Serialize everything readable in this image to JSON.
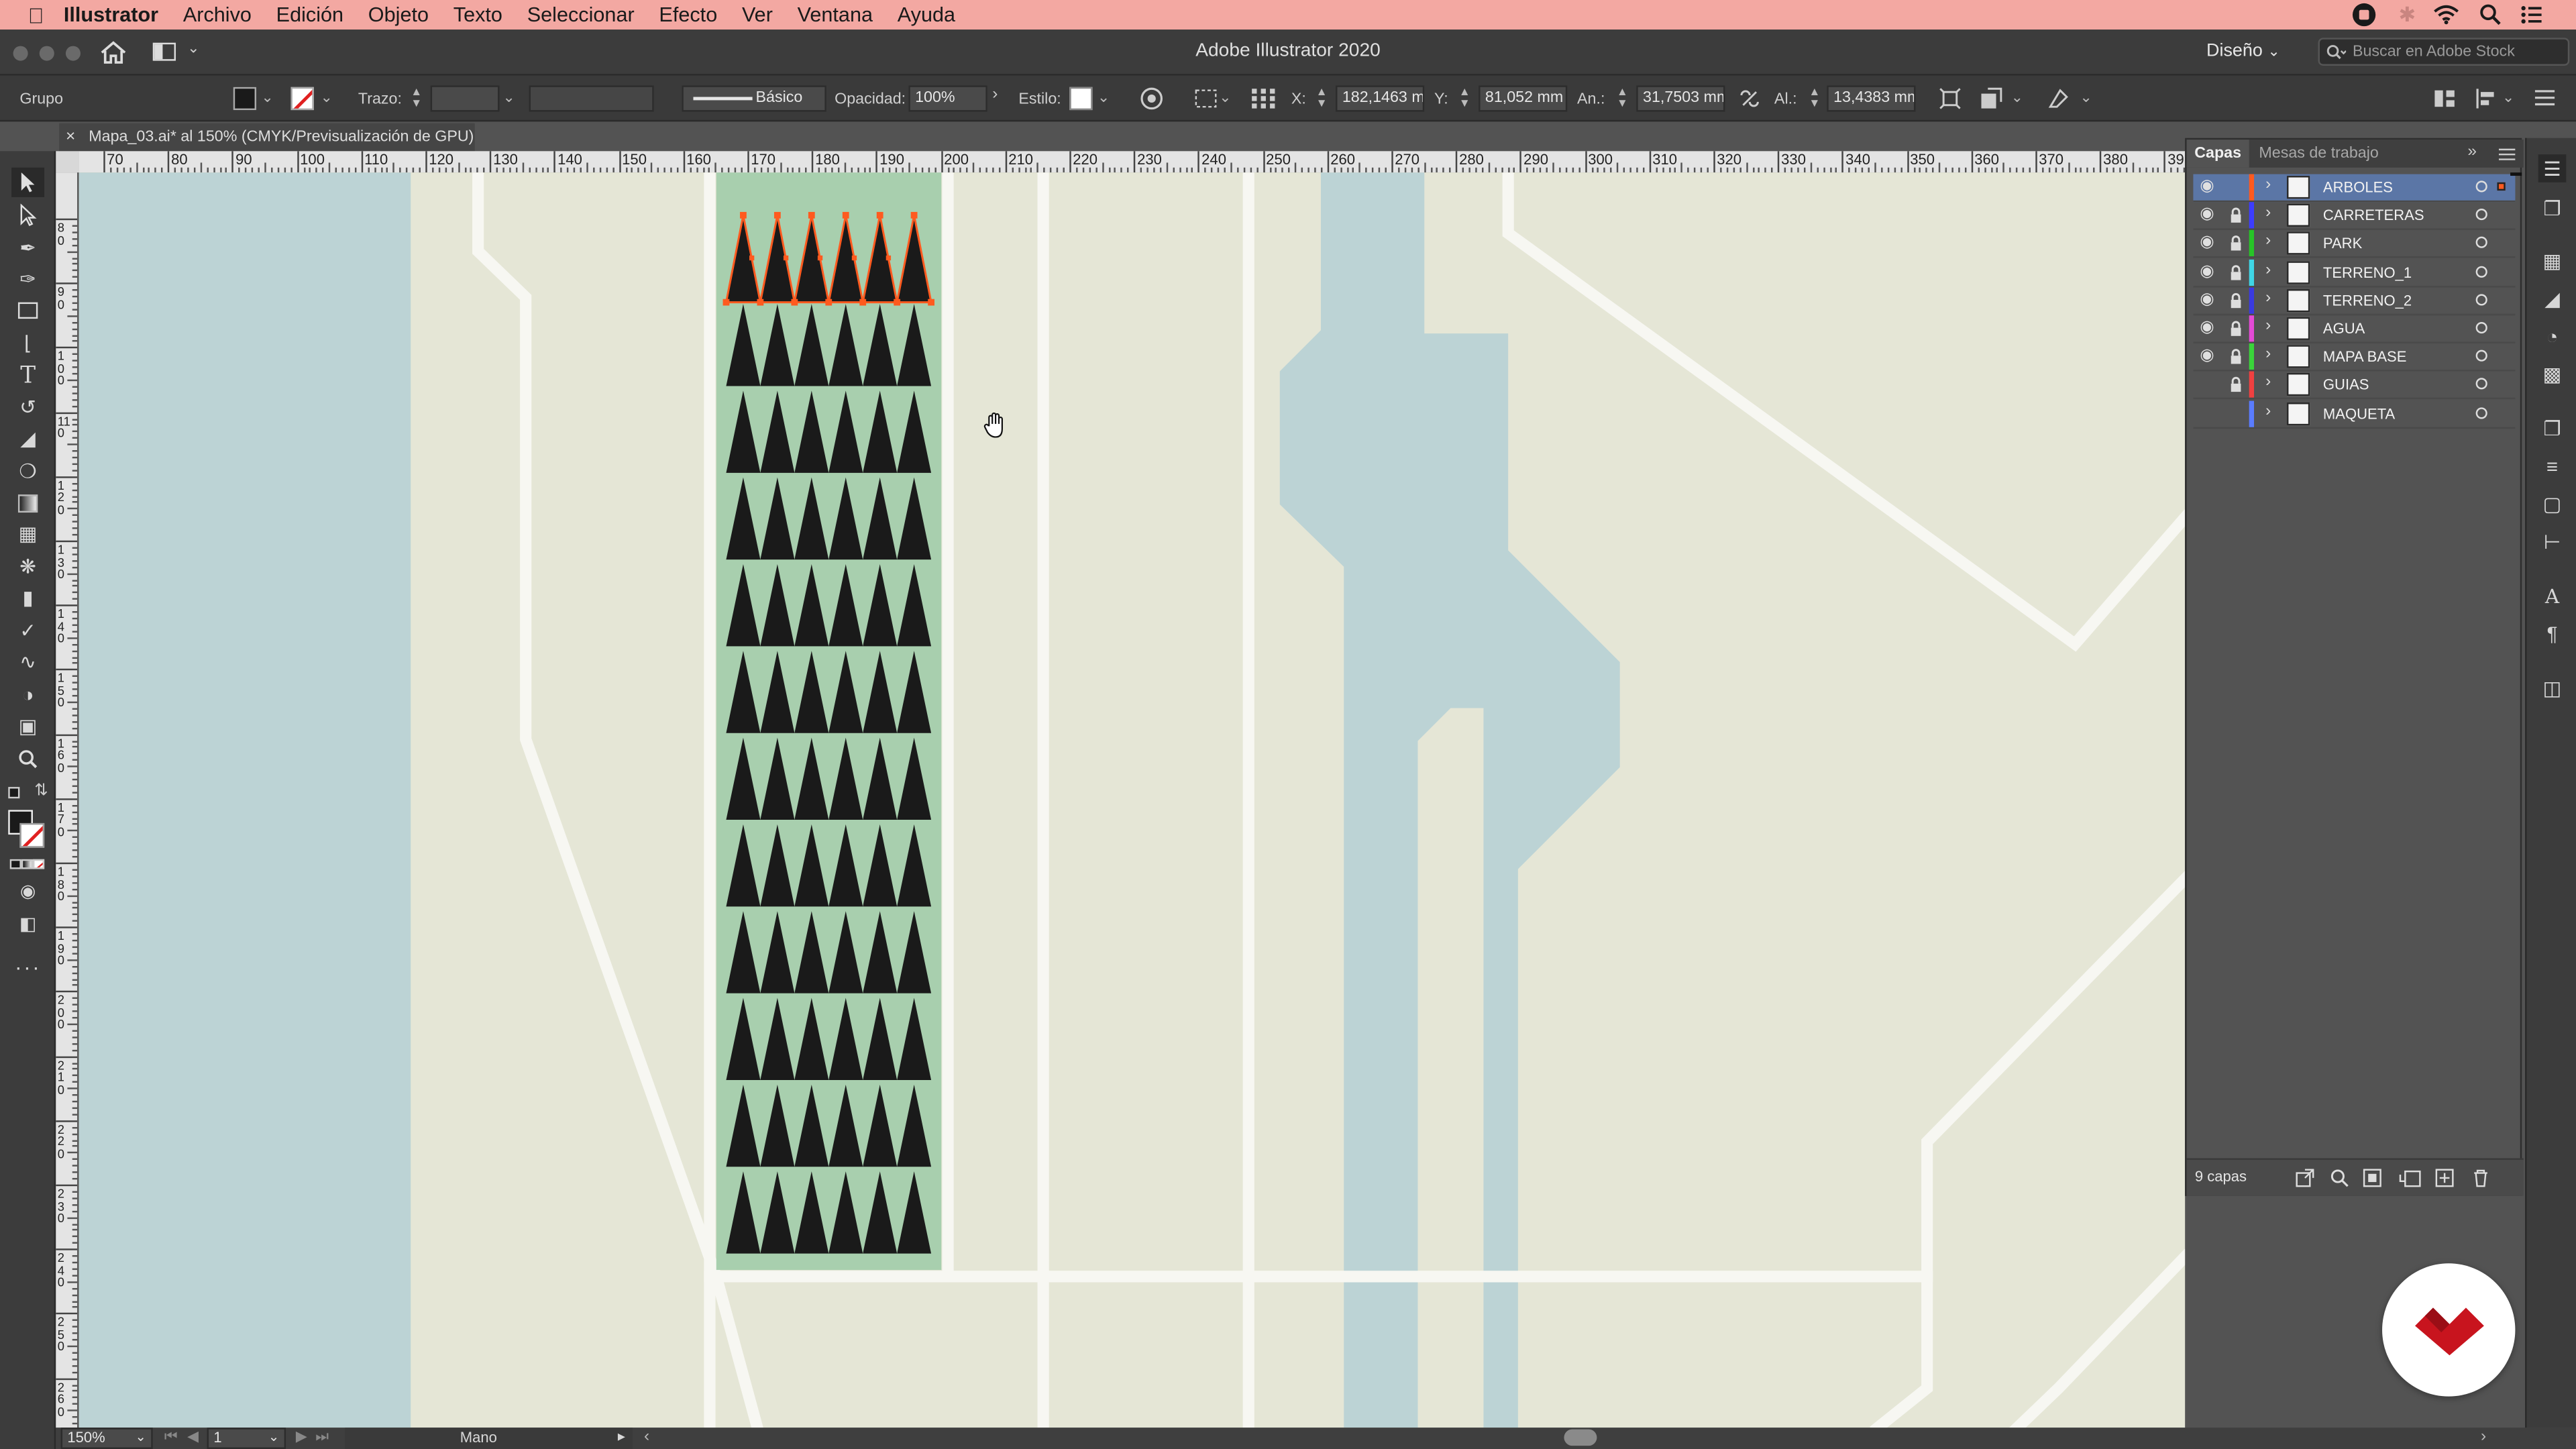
{
  "menubar": {
    "app": "Illustrator",
    "items": [
      "Archivo",
      "Edición",
      "Objeto",
      "Texto",
      "Seleccionar",
      "Efecto",
      "Ver",
      "Ventana",
      "Ayuda"
    ]
  },
  "titlebar": {
    "title": "Adobe Illustrator 2020",
    "workspace": "Diseño",
    "search_placeholder": "Buscar en Adobe Stock"
  },
  "control": {
    "selection_label": "Grupo",
    "stroke_label": "Trazo:",
    "brush_label": "Básico",
    "opacity_label": "Opacidad:",
    "opacity_value": "100%",
    "style_label": "Estilo:",
    "x_label": "X:",
    "x_value": "182,1463 m",
    "y_label": "Y:",
    "y_value": "81,052 mm",
    "w_label": "An.:",
    "w_value": "31,7503 mm",
    "h_label": "Al.:",
    "h_value": "13,4383 mm"
  },
  "document": {
    "tab_title": "Mapa_03.ai* al 150% (CMYK/Previsualización de GPU)"
  },
  "ruler": {
    "h_ticks": [
      "70",
      "80",
      "90",
      "100",
      "110",
      "120",
      "130",
      "140",
      "150",
      "160",
      "170",
      "180",
      "190",
      "200",
      "210",
      "220",
      "230",
      "240",
      "250",
      "260",
      "270",
      "280",
      "290",
      "300",
      "310",
      "320",
      "330",
      "340",
      "350",
      "360",
      "370",
      "380",
      "39"
    ],
    "v_ticks": [
      "80",
      "90",
      "100",
      "110",
      "120",
      "130",
      "140",
      "150",
      "160",
      "170",
      "180",
      "190",
      "200",
      "210",
      "220",
      "230",
      "240",
      "250",
      "260"
    ]
  },
  "layers_panel": {
    "tab_layers": "Capas",
    "tab_artboards": "Mesas de trabajo",
    "count_label": "9 capas",
    "layers": [
      {
        "name": "ARBOLES",
        "visible": true,
        "locked": false,
        "color": "#ff5a1f",
        "selected": true
      },
      {
        "name": "CARRETERAS",
        "visible": true,
        "locked": true,
        "color": "#3d3dff",
        "selected": false
      },
      {
        "name": "PARK",
        "visible": true,
        "locked": true,
        "color": "#27c427",
        "selected": false
      },
      {
        "name": "TERRENO_1",
        "visible": true,
        "locked": true,
        "color": "#3fd6e6",
        "selected": false
      },
      {
        "name": "TERRENO_2",
        "visible": true,
        "locked": true,
        "color": "#3a3adf",
        "selected": false
      },
      {
        "name": "AGUA",
        "visible": true,
        "locked": true,
        "color": "#e44ad6",
        "selected": false
      },
      {
        "name": "MAPA BASE",
        "visible": true,
        "locked": true,
        "color": "#3ad43a",
        "selected": false
      },
      {
        "name": "GUIAS",
        "visible": false,
        "locked": true,
        "color": "#f04040",
        "selected": false
      },
      {
        "name": "MAQUETA",
        "visible": false,
        "locked": false,
        "color": "#5a7cff",
        "selected": false
      }
    ]
  },
  "status": {
    "zoom": "150%",
    "artboard": "1",
    "tool": "Mano"
  },
  "colors": {
    "menubar": "#f3a8a2",
    "water": "#bcd3d5",
    "land": "#e5e6d6",
    "park": "#a8cfae",
    "road": "#f7f7f2",
    "tree": "#1a1a1a",
    "selection": "#ff5a1f",
    "logo": "#c8141e"
  }
}
